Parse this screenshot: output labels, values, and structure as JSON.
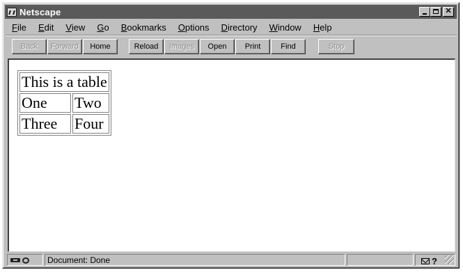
{
  "window": {
    "title": "Netscape"
  },
  "menubar": {
    "items": [
      {
        "pre": "",
        "key": "F",
        "post": "ile"
      },
      {
        "pre": "",
        "key": "E",
        "post": "dit"
      },
      {
        "pre": "",
        "key": "V",
        "post": "iew"
      },
      {
        "pre": "",
        "key": "G",
        "post": "o"
      },
      {
        "pre": "",
        "key": "B",
        "post": "ookmarks"
      },
      {
        "pre": "",
        "key": "O",
        "post": "ptions"
      },
      {
        "pre": "",
        "key": "D",
        "post": "irectory"
      },
      {
        "pre": "",
        "key": "W",
        "post": "indow"
      },
      {
        "pre": "",
        "key": "H",
        "post": "elp"
      }
    ]
  },
  "toolbar": {
    "back": "Back",
    "forward": "Forward",
    "home": "Home",
    "reload": "Reload",
    "images": "Images",
    "open": "Open",
    "print": "Print",
    "find": "Find",
    "stop": "Stop"
  },
  "document": {
    "table": {
      "caption_row": "This is a table",
      "rows": [
        [
          "One",
          "Two"
        ],
        [
          "Three",
          "Four"
        ]
      ]
    }
  },
  "status": {
    "text": "Document: Done"
  },
  "icons": {
    "security": "key-lock-icon",
    "mail": "mail-icon",
    "help": "help-icon"
  }
}
